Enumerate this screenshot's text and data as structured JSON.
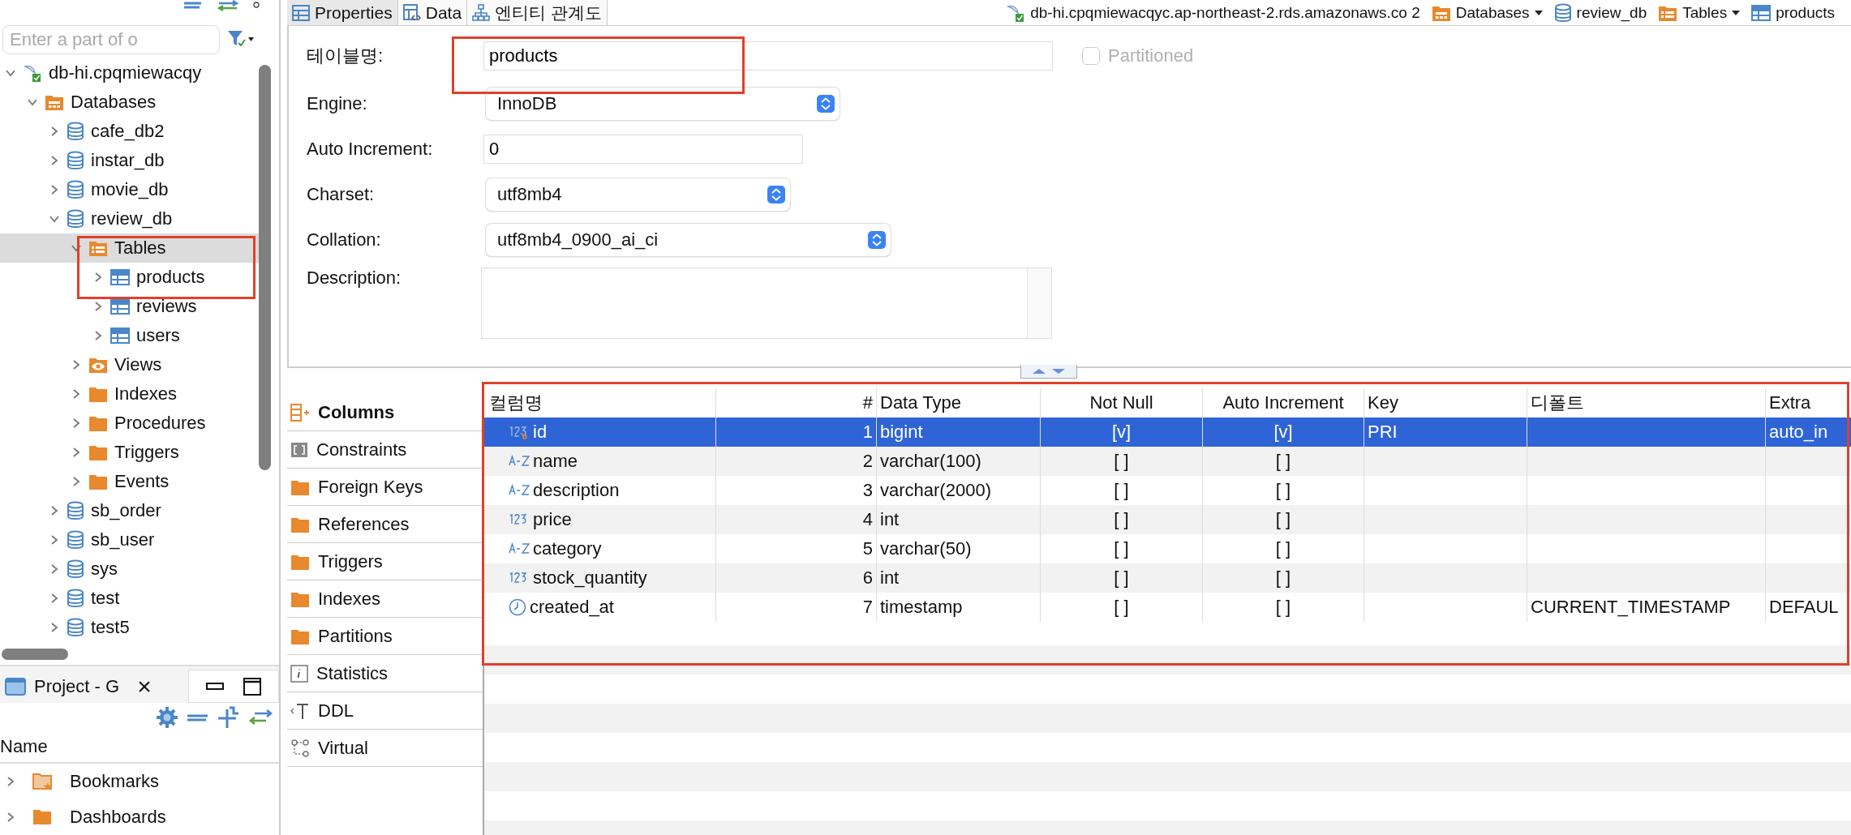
{
  "navigator": {
    "search": {
      "placeholder": "Enter a part of o"
    },
    "tree": [
      {
        "label": "db-hi.cpqmiewacqy",
        "kind": "connection",
        "expanded": true,
        "selected": false,
        "children": [
          {
            "label": "Databases",
            "kind": "databases",
            "expanded": true,
            "selected": false,
            "children": [
              {
                "label": "cafe_db2",
                "kind": "database",
                "expanded": false,
                "selected": false
              },
              {
                "label": "instar_db",
                "kind": "database",
                "expanded": false,
                "selected": false
              },
              {
                "label": "movie_db",
                "kind": "database",
                "expanded": false,
                "selected": false
              },
              {
                "label": "review_db",
                "kind": "database",
                "expanded": true,
                "selected": false,
                "children": [
                  {
                    "label": "Tables",
                    "kind": "tables",
                    "expanded": true,
                    "selected": true,
                    "children": [
                      {
                        "label": "products",
                        "kind": "table",
                        "expanded": false,
                        "selected": false
                      },
                      {
                        "label": "reviews",
                        "kind": "table",
                        "expanded": false,
                        "selected": false
                      },
                      {
                        "label": "users",
                        "kind": "table",
                        "expanded": false,
                        "selected": false
                      }
                    ]
                  },
                  {
                    "label": "Views",
                    "kind": "views",
                    "expanded": false,
                    "selected": false
                  },
                  {
                    "label": "Indexes",
                    "kind": "folder",
                    "expanded": false,
                    "selected": false
                  },
                  {
                    "label": "Procedures",
                    "kind": "folder",
                    "expanded": false,
                    "selected": false
                  },
                  {
                    "label": "Triggers",
                    "kind": "folder",
                    "expanded": false,
                    "selected": false
                  },
                  {
                    "label": "Events",
                    "kind": "folder",
                    "expanded": false,
                    "selected": false
                  }
                ]
              },
              {
                "label": "sb_order",
                "kind": "database",
                "expanded": false,
                "selected": false
              },
              {
                "label": "sb_user",
                "kind": "database",
                "expanded": false,
                "selected": false
              },
              {
                "label": "sys",
                "kind": "database",
                "expanded": false,
                "selected": false
              },
              {
                "label": "test",
                "kind": "database",
                "expanded": false,
                "selected": false
              },
              {
                "label": "test5",
                "kind": "database",
                "expanded": false,
                "selected": false
              }
            ]
          }
        ]
      }
    ]
  },
  "project": {
    "tab": "Project - G",
    "close": "×",
    "header": "Name",
    "items": [
      {
        "label": "Bookmarks",
        "kind": "bookmarks",
        "expanded": false
      },
      {
        "label": "Dashboards",
        "kind": "dashboards",
        "expanded": false
      }
    ]
  },
  "editor_tabs": [
    {
      "label": "Properties",
      "kind": "properties",
      "selected": true
    },
    {
      "label": "Data",
      "kind": "data",
      "selected": false
    },
    {
      "label": "엔티티 관계도",
      "kind": "diagram",
      "selected": false
    }
  ],
  "breadcrumb": [
    {
      "label": "db-hi.cpqmiewacqyc.ap-northeast-2.rds.amazonaws.co 2",
      "kind": "connection",
      "dropdown": false
    },
    {
      "label": "Databases",
      "kind": "databases",
      "dropdown": true
    },
    {
      "label": "review_db",
      "kind": "database",
      "dropdown": false
    },
    {
      "label": "Tables",
      "kind": "tables",
      "dropdown": true
    },
    {
      "label": "products",
      "kind": "table",
      "dropdown": false
    }
  ],
  "properties": {
    "table_name": {
      "label": "테이블명:",
      "value": "products"
    },
    "partitioned": {
      "label": "Partitioned",
      "checked": false,
      "disabled": true
    },
    "engine": {
      "label": "Engine:",
      "value": "InnoDB"
    },
    "auto_increment": {
      "label": "Auto Increment:",
      "value": "0"
    },
    "charset": {
      "label": "Charset:",
      "value": "utf8mb4"
    },
    "collation": {
      "label": "Collation:",
      "value": "utf8mb4_0900_ai_ci"
    },
    "description": {
      "label": "Description:"
    }
  },
  "side_tabs": [
    {
      "label": "Columns",
      "kind": "columns",
      "selected": true
    },
    {
      "label": "Constraints",
      "kind": "constraints",
      "selected": false
    },
    {
      "label": "Foreign Keys",
      "kind": "folder",
      "selected": false
    },
    {
      "label": "References",
      "kind": "folder",
      "selected": false
    },
    {
      "label": "Triggers",
      "kind": "folder",
      "selected": false
    },
    {
      "label": "Indexes",
      "kind": "folder",
      "selected": false
    },
    {
      "label": "Partitions",
      "kind": "folder",
      "selected": false
    },
    {
      "label": "Statistics",
      "kind": "statistics",
      "selected": false
    },
    {
      "label": "DDL",
      "kind": "ddl",
      "selected": false
    },
    {
      "label": "Virtual",
      "kind": "virtual",
      "selected": false
    }
  ],
  "table": {
    "columns": [
      "컬럼명",
      "#",
      "Data Type",
      "Not Null",
      "Auto Increment",
      "Key",
      "디폴트",
      "Extra"
    ],
    "rows": [
      {
        "kind": "primary-number",
        "name": "id",
        "number": "1",
        "data_type": "bigint",
        "not_null": "[v]",
        "auto_increment": "[v]",
        "key": "PRI",
        "extra": "auto_in",
        "selected": true
      },
      {
        "kind": "text",
        "name": "name",
        "number": "2",
        "data_type": "varchar(100)",
        "not_null": "[ ]",
        "auto_increment": "[ ]",
        "selected": false
      },
      {
        "kind": "text",
        "name": "description",
        "number": "3",
        "data_type": "varchar(2000)",
        "not_null": "[ ]",
        "auto_increment": "[ ]",
        "selected": false
      },
      {
        "kind": "number",
        "name": "price",
        "number": "4",
        "data_type": "int",
        "not_null": "[ ]",
        "auto_increment": "[ ]",
        "selected": false
      },
      {
        "kind": "text",
        "name": "category",
        "number": "5",
        "data_type": "varchar(50)",
        "not_null": "[ ]",
        "auto_increment": "[ ]",
        "selected": false
      },
      {
        "kind": "number",
        "name": "stock_quantity",
        "number": "6",
        "data_type": "int",
        "not_null": "[ ]",
        "auto_increment": "[ ]",
        "selected": false
      },
      {
        "kind": "datetime",
        "name": "created_at",
        "number": "7",
        "data_type": "timestamp",
        "not_null": "[ ]",
        "auto_increment": "[ ]",
        "default": "CURRENT_TIMESTAMP",
        "extra": "DEFAUL",
        "selected": false
      }
    ]
  }
}
